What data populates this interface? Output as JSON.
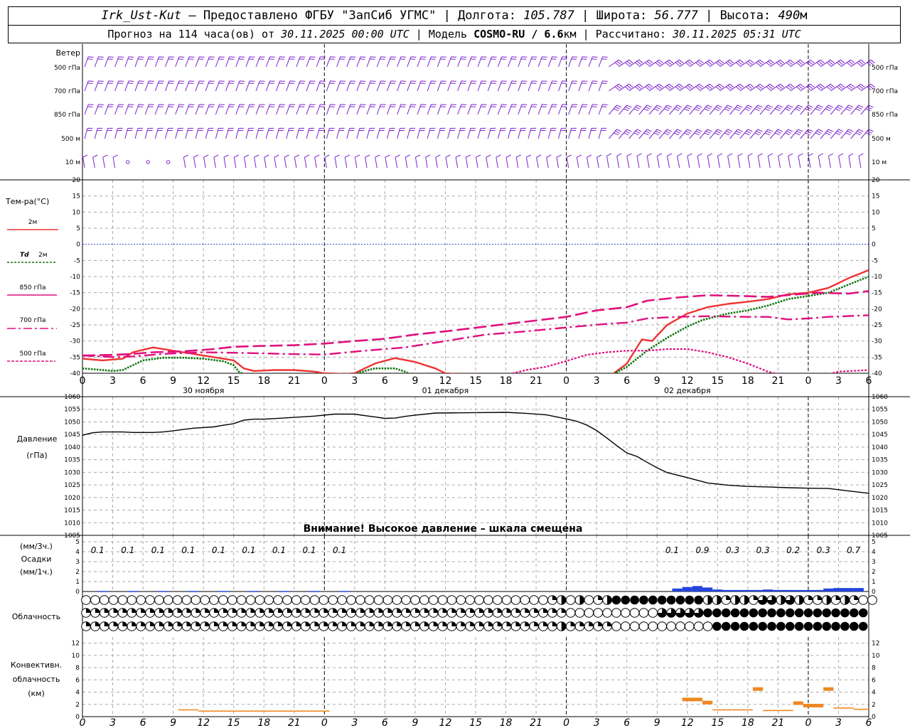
{
  "header": {
    "station": "Irk_Ust-Kut",
    "provider": "– Предоставлено ФГБУ \"ЗапСиб УГМС\"",
    "lon_label": "Долгота:",
    "lon_value": "105.787",
    "lat_label": "Широта:",
    "lat_value": "56.777",
    "alt_label": "Высота:",
    "alt_value": "490",
    "alt_unit": "м",
    "forecast_prefix": "Прогноз на 114 часа(ов) от",
    "forecast_start": "30.11.2025 00:00 UTC",
    "model_label": "Модель",
    "model_name": "COSMO-RU / 6.6",
    "model_unit": "км",
    "computed_label": "Рассчитано:",
    "computed_value": "30.11.2025 05:31 UTC"
  },
  "colors": {
    "t2m": "#ee3333",
    "td2m": "#117711",
    "t850": "#e0107e",
    "t700": "#e0107e",
    "t500": "#e0107e",
    "wind": "#7a22cc",
    "zero_line": "#3344cc",
    "precip": "#2244dd",
    "convective": "#ee8822",
    "grid": "#aaaaaa",
    "pressure": "#000000"
  },
  "labels": {
    "wind_title": "Ветер",
    "wind_levels": [
      "500 гПа",
      "700 гПа",
      "850 гПа",
      "500 м",
      "10 м"
    ],
    "temp_title": "Тем-ра(°C)",
    "t2m": "2м",
    "td_sym": "Td",
    "td_lvl": "2м",
    "t850": "850 гПа",
    "t700": "700 гПа",
    "t500": "500 гПа",
    "pressure_title": "Давление",
    "pressure_unit": "(гПа)",
    "warning": "Внимание! Высокое давление – шкала смещена",
    "precip_unit3": "(мм/3ч.)",
    "precip_title": "Осадки",
    "precip_unit1": "(мм/1ч.)",
    "cloud_title": "Облачность",
    "conv_title1": "Конвективн.",
    "conv_title2": "облачность",
    "conv_unit": "(км)"
  },
  "chart_data": {
    "type": "line",
    "x_hour_ticks": [
      "0",
      "3",
      "6",
      "9",
      "12",
      "15",
      "18",
      "21",
      "0",
      "3",
      "6",
      "9",
      "12",
      "15",
      "18",
      "21",
      "0",
      "3",
      "6",
      "9",
      "12",
      "15",
      "18",
      "21",
      "0",
      "3",
      "6"
    ],
    "x_tick_hours": [
      0,
      3,
      6,
      9,
      12,
      15,
      18,
      21,
      24,
      27,
      30,
      33,
      36,
      39,
      42,
      45,
      48,
      51,
      54,
      57,
      60,
      63,
      66,
      69,
      72,
      75,
      78
    ],
    "day_labels": [
      "30 ноября",
      "01 декабря",
      "02 декабря"
    ],
    "day_label_hours": [
      12,
      36,
      60
    ],
    "temperature": {
      "ylim": [
        -40,
        20
      ],
      "yticks": [
        20,
        15,
        10,
        5,
        0,
        -5,
        -10,
        -15,
        -20,
        -25,
        -30,
        -35,
        -40
      ],
      "series": [
        {
          "name": "2м",
          "style": "solid",
          "points": [
            [
              0,
              -35.5
            ],
            [
              2,
              -36
            ],
            [
              4,
              -35.5
            ],
            [
              5,
              -33.5
            ],
            [
              7,
              -32
            ],
            [
              9,
              -33
            ],
            [
              11,
              -34
            ],
            [
              13,
              -35
            ],
            [
              15,
              -36
            ],
            [
              16,
              -38.5
            ],
            [
              17,
              -39.3
            ],
            [
              19,
              -39
            ],
            [
              21,
              -39
            ],
            [
              23,
              -39.5
            ],
            [
              24,
              -40
            ],
            [
              26,
              -40.2
            ],
            [
              27,
              -40
            ],
            [
              29,
              -37
            ],
            [
              31,
              -35.3
            ],
            [
              33,
              -36.5
            ],
            [
              35,
              -38.5
            ],
            [
              36,
              -40
            ],
            [
              37,
              -40.2
            ],
            [
              52.5,
              -40.5
            ],
            [
              54,
              -37
            ],
            [
              55.5,
              -29.5
            ],
            [
              56.5,
              -30
            ],
            [
              58,
              -25
            ],
            [
              60,
              -21.5
            ],
            [
              62,
              -19.5
            ],
            [
              64,
              -18.5
            ],
            [
              66,
              -17.8
            ],
            [
              68,
              -17
            ],
            [
              70,
              -15.5
            ],
            [
              72,
              -15
            ],
            [
              74,
              -13.5
            ],
            [
              76,
              -10.5
            ],
            [
              78,
              -8
            ]
          ]
        },
        {
          "name": "Td 2м",
          "style": "dot",
          "points": [
            [
              0,
              -38.5
            ],
            [
              2,
              -39
            ],
            [
              3,
              -39.3
            ],
            [
              4,
              -39
            ],
            [
              5,
              -37.5
            ],
            [
              6,
              -36
            ],
            [
              8,
              -35.2
            ],
            [
              10,
              -35.2
            ],
            [
              12,
              -35.5
            ],
            [
              14,
              -36.3
            ],
            [
              15,
              -37.5
            ],
            [
              15.5,
              -39.5
            ],
            [
              16,
              -40.3
            ],
            [
              27,
              -40.3
            ],
            [
              28,
              -39.3
            ],
            [
              29,
              -38.5
            ],
            [
              31,
              -38.5
            ],
            [
              32,
              -39.5
            ],
            [
              32.5,
              -40.3
            ],
            [
              52.5,
              -40.5
            ],
            [
              54,
              -38
            ],
            [
              56,
              -33
            ],
            [
              58,
              -29
            ],
            [
              60,
              -25.5
            ],
            [
              61.5,
              -23.5
            ],
            [
              64,
              -21.5
            ],
            [
              66,
              -20.5
            ],
            [
              68,
              -19
            ],
            [
              70,
              -17
            ],
            [
              72,
              -16
            ],
            [
              74,
              -15
            ],
            [
              76,
              -12.5
            ],
            [
              78,
              -10
            ]
          ]
        },
        {
          "name": "850 гПа",
          "style": "dash",
          "points": [
            [
              0,
              -34.5
            ],
            [
              3,
              -34.3
            ],
            [
              5,
              -34
            ],
            [
              7,
              -33.5
            ],
            [
              10,
              -33.2
            ],
            [
              13,
              -32.5
            ],
            [
              15,
              -31.8
            ],
            [
              18,
              -31.5
            ],
            [
              21,
              -31.3
            ],
            [
              24,
              -30.8
            ],
            [
              27,
              -30
            ],
            [
              30,
              -29.3
            ],
            [
              33,
              -28
            ],
            [
              36,
              -27
            ],
            [
              40,
              -25.5
            ],
            [
              44,
              -24
            ],
            [
              48,
              -22.5
            ],
            [
              51,
              -20.5
            ],
            [
              54,
              -19.5
            ],
            [
              56,
              -17.5
            ],
            [
              59,
              -16.5
            ],
            [
              62,
              -15.8
            ],
            [
              65,
              -16
            ],
            [
              68,
              -16.3
            ],
            [
              71,
              -15.5
            ],
            [
              73,
              -15
            ],
            [
              76,
              -15.3
            ],
            [
              78,
              -14.5
            ]
          ]
        },
        {
          "name": "700 гПа",
          "style": "dashdot",
          "points": [
            [
              0,
              -34.5
            ],
            [
              3,
              -35
            ],
            [
              5,
              -34.8
            ],
            [
              8,
              -34
            ],
            [
              12,
              -33.5
            ],
            [
              16,
              -33.7
            ],
            [
              20,
              -34
            ],
            [
              24,
              -34.2
            ],
            [
              28,
              -33
            ],
            [
              32,
              -32
            ],
            [
              36,
              -30
            ],
            [
              40,
              -28
            ],
            [
              44,
              -27
            ],
            [
              48,
              -25.8
            ],
            [
              52,
              -24.7
            ],
            [
              54,
              -24.3
            ],
            [
              56,
              -23
            ],
            [
              59,
              -22.5
            ],
            [
              62,
              -22.3
            ],
            [
              66,
              -22.5
            ],
            [
              68,
              -22.5
            ],
            [
              70,
              -23.3
            ],
            [
              72,
              -23
            ],
            [
              74,
              -22.5
            ],
            [
              78,
              -22
            ]
          ]
        },
        {
          "name": "500 гПа",
          "style": "shortdash",
          "points": [
            [
              42.3,
              -40.3
            ],
            [
              44,
              -39
            ],
            [
              46,
              -38
            ],
            [
              48,
              -36.2
            ],
            [
              50,
              -34.3
            ],
            [
              52,
              -33.5
            ],
            [
              54,
              -33
            ],
            [
              56,
              -33
            ],
            [
              58,
              -32.5
            ],
            [
              60,
              -32.5
            ],
            [
              62,
              -33.5
            ],
            [
              64,
              -35
            ],
            [
              66,
              -37
            ],
            [
              68,
              -39.5
            ],
            [
              69,
              -40.3
            ],
            [
              74,
              -40.3
            ],
            [
              75,
              -39.5
            ],
            [
              78,
              -39
            ]
          ]
        }
      ]
    },
    "pressure": {
      "ylim": [
        1005,
        1060
      ],
      "yticks": [
        1060,
        1055,
        1050,
        1045,
        1040,
        1035,
        1030,
        1025,
        1020,
        1015,
        1010,
        1005
      ],
      "points": [
        [
          0,
          1044.7
        ],
        [
          1,
          1045.7
        ],
        [
          2,
          1046
        ],
        [
          3,
          1046
        ],
        [
          4,
          1046
        ],
        [
          5,
          1045.8
        ],
        [
          6,
          1045.8
        ],
        [
          7,
          1045.8
        ],
        [
          8,
          1046
        ],
        [
          9,
          1046.5
        ],
        [
          10,
          1047
        ],
        [
          11,
          1047.5
        ],
        [
          13,
          1048
        ],
        [
          14,
          1048.7
        ],
        [
          15,
          1049.3
        ],
        [
          16,
          1050.7
        ],
        [
          17,
          1051.1
        ],
        [
          18,
          1051.1
        ],
        [
          19,
          1051.3
        ],
        [
          21,
          1051.8
        ],
        [
          23,
          1052.3
        ],
        [
          25,
          1053.1
        ],
        [
          27,
          1053.1
        ],
        [
          28,
          1052.5
        ],
        [
          29,
          1052
        ],
        [
          30,
          1051.4
        ],
        [
          31,
          1051.5
        ],
        [
          32,
          1052.2
        ],
        [
          33,
          1052.7
        ],
        [
          34,
          1053.1
        ],
        [
          35,
          1053.5
        ],
        [
          37,
          1053.6
        ],
        [
          40,
          1053.7
        ],
        [
          42,
          1053.8
        ],
        [
          44,
          1053.4
        ],
        [
          46,
          1052.8
        ],
        [
          48,
          1051.2
        ],
        [
          49,
          1050.3
        ],
        [
          50,
          1048.8
        ],
        [
          51,
          1046.6
        ],
        [
          52,
          1043.7
        ],
        [
          53,
          1040.6
        ],
        [
          54,
          1037.7
        ],
        [
          55,
          1036.3
        ],
        [
          56,
          1034
        ],
        [
          57,
          1031.8
        ],
        [
          58,
          1029.9
        ],
        [
          60,
          1027.9
        ],
        [
          62,
          1025.8
        ],
        [
          64,
          1024.9
        ],
        [
          66,
          1024.4
        ],
        [
          68,
          1024.2
        ],
        [
          70,
          1023.9
        ],
        [
          72,
          1023.7
        ],
        [
          74,
          1023.6
        ],
        [
          76,
          1022.6
        ],
        [
          78,
          1021.7
        ]
      ]
    },
    "precip_3h_values": [
      "0.1",
      "0.1",
      "0.1",
      "0.1",
      "0.1",
      "0.1",
      "0.1",
      "0.1",
      "0.1",
      "0.1",
      "0.9",
      "0.3",
      "0.3",
      "0.2",
      "0.3",
      "0.7"
    ],
    "precip_3h_hours": [
      1.5,
      4.5,
      7.5,
      10.5,
      13.5,
      16.5,
      19.5,
      22.5,
      25.5,
      58.5,
      61.5,
      64.5,
      67.5,
      70.5,
      73.5,
      76.5
    ],
    "precip": {
      "ylim": [
        0,
        5
      ],
      "yticks": [
        5,
        4,
        3,
        2,
        1,
        0
      ],
      "bars_1h": [
        [
          2,
          0.05
        ],
        [
          5,
          0.05
        ],
        [
          8,
          0.05
        ],
        [
          11,
          0.05
        ],
        [
          14,
          0.05
        ],
        [
          17,
          0.05
        ],
        [
          20,
          0.05
        ],
        [
          23,
          0.05
        ],
        [
          26,
          0.05
        ],
        [
          59,
          0.3
        ],
        [
          60,
          0.45
        ],
        [
          61,
          0.55
        ],
        [
          62,
          0.4
        ],
        [
          63,
          0.2
        ],
        [
          64,
          0.15
        ],
        [
          65,
          0.15
        ],
        [
          66,
          0.15
        ],
        [
          67,
          0.15
        ],
        [
          68,
          0.2
        ],
        [
          69,
          0.15
        ],
        [
          70,
          0.15
        ],
        [
          71,
          0.15
        ],
        [
          72,
          0.15
        ],
        [
          73,
          0.15
        ],
        [
          74,
          0.3
        ],
        [
          75,
          0.35
        ],
        [
          76,
          0.35
        ],
        [
          77,
          0.35
        ]
      ]
    },
    "clouds": {
      "rows": [
        "000000000000000000000000000000000000000000000000000230302388888888883323325535322323200",
        "22222222222222222222222222222222222222222222222222222000000000055555888888888888888888",
        "22222222222222222222222222222222222222222222222222223222220000000000088888888888888888"
      ]
    },
    "convective": {
      "ylim": [
        0,
        13
      ],
      "yticks": [
        12,
        10,
        8,
        6,
        4,
        2,
        0
      ],
      "segments": [
        [
          9.5,
          11.5,
          1.1
        ],
        [
          11.5,
          24.5,
          0.9
        ],
        [
          59.5,
          61.5,
          2.8
        ],
        [
          61.5,
          62.5,
          2.3
        ],
        [
          62.5,
          66.5,
          1.1
        ],
        [
          66.5,
          67.5,
          4.5
        ],
        [
          67.5,
          70.5,
          1.0
        ],
        [
          70.5,
          71.5,
          2.2
        ],
        [
          71.5,
          73.5,
          1.8
        ],
        [
          73.5,
          74.5,
          4.5
        ],
        [
          74.5,
          76.5,
          1.4
        ],
        [
          76.5,
          78,
          1.2
        ]
      ]
    }
  }
}
